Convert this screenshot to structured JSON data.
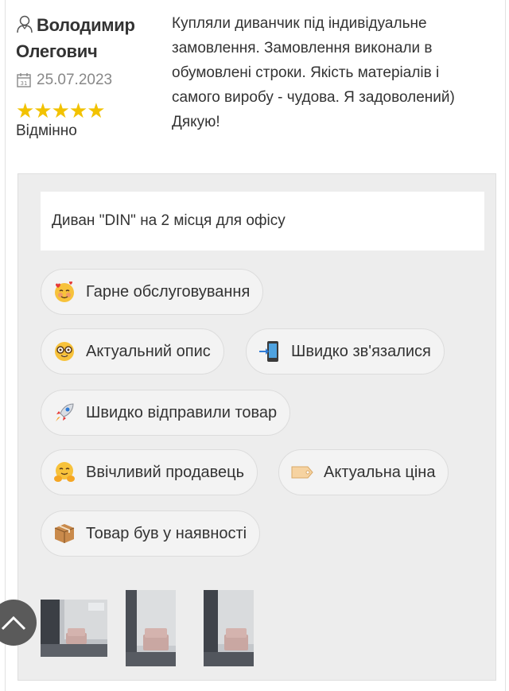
{
  "review": {
    "author_first": "Володимир",
    "author_last": "Олегович",
    "date": "25.07.2023",
    "stars": "★★★★★",
    "rating_label": "Відмінно",
    "text": "Купляли диванчик під індивідуальне замовлення. Замовлення виконали в обумовлені строки. Якість матеріалів і самого виробу - чудова. Я задоволений) Дякую!"
  },
  "product": {
    "title": "Диван \"DIN\" на 2 місця для офісу"
  },
  "tags": [
    {
      "label": "Гарне обслуговування",
      "icon": "smiling-face-with-hearts-icon"
    },
    {
      "label": "Актуальний опис",
      "icon": "nerd-face-icon"
    },
    {
      "label": "Швидко зв'язалися",
      "icon": "mobile-phone-arrow-icon"
    },
    {
      "label": "Швидко відправили товар",
      "icon": "rocket-icon"
    },
    {
      "label": "Ввічливий продавець",
      "icon": "hugging-face-icon"
    },
    {
      "label": "Актуальна ціна",
      "icon": "price-tag-icon"
    },
    {
      "label": "Товар був у наявності",
      "icon": "package-icon"
    }
  ],
  "photos": [
    {
      "icon": "photo-thumbnail-1"
    },
    {
      "icon": "photo-thumbnail-2"
    },
    {
      "icon": "photo-thumbnail-3"
    }
  ],
  "colors": {
    "star": "#f2c200",
    "panel": "#ededed",
    "tag_bg": "#f3f3f3",
    "scroll_button": "#5a5a5a"
  }
}
